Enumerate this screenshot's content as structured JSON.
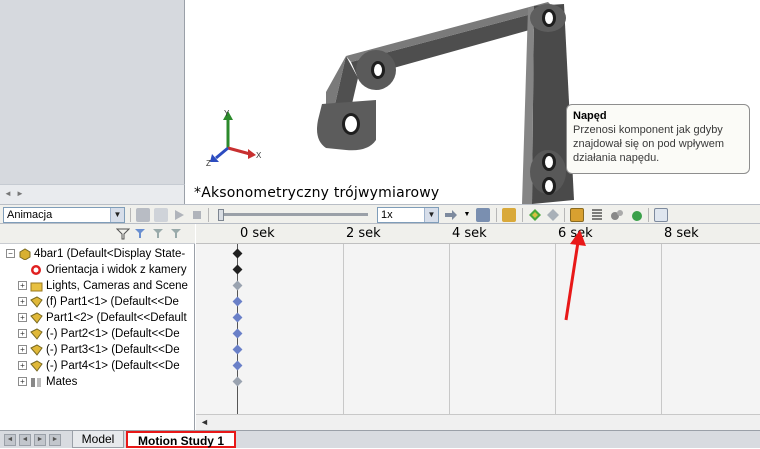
{
  "viewport": {
    "view_label": "*Aksonometryczny trójwymiarowy",
    "axes": [
      "Y",
      "X",
      "Z"
    ]
  },
  "tooltip": {
    "title": "Napęd",
    "body": "Przenosi komponent jak gdyby znajdował się on pod wpływem działania napędu."
  },
  "toolbar": {
    "study_type": "Animacja",
    "playback_speed": "1x"
  },
  "tree": {
    "items": [
      {
        "label": "4bar1  (Default<Display State-",
        "expander": "⊟",
        "icon": "assembly-icon"
      },
      {
        "label": "Orientacja i widok z kamery",
        "expander": "",
        "icon": "orientation-icon"
      },
      {
        "label": "Lights, Cameras and Scene",
        "expander": "⊞",
        "icon": "lights-folder-icon"
      },
      {
        "label": "(f) Part1<1> (Default<<De",
        "expander": "⊞",
        "icon": "part-icon"
      },
      {
        "label": "Part1<2> (Default<<Default",
        "expander": "⊞",
        "icon": "part-icon"
      },
      {
        "label": "(-) Part2<1> (Default<<De",
        "expander": "⊞",
        "icon": "part-icon"
      },
      {
        "label": "(-) Part3<1> (Default<<De",
        "expander": "⊞",
        "icon": "part-icon"
      },
      {
        "label": "(-) Part4<1> (Default<<De",
        "expander": "⊞",
        "icon": "part-icon"
      },
      {
        "label": "Mates",
        "expander": "⊞",
        "icon": "mates-icon"
      }
    ]
  },
  "timeline": {
    "ticks": [
      "0 sek",
      "2 sek",
      "4 sek",
      "6 sek",
      "8 sek"
    ]
  },
  "tabs": {
    "model": "Model",
    "motion_study": "Motion Study 1"
  },
  "colors": {
    "highlight": "#e81818",
    "keyframe_dark": "#202020",
    "keyframe_light": "#9aa3b0"
  }
}
